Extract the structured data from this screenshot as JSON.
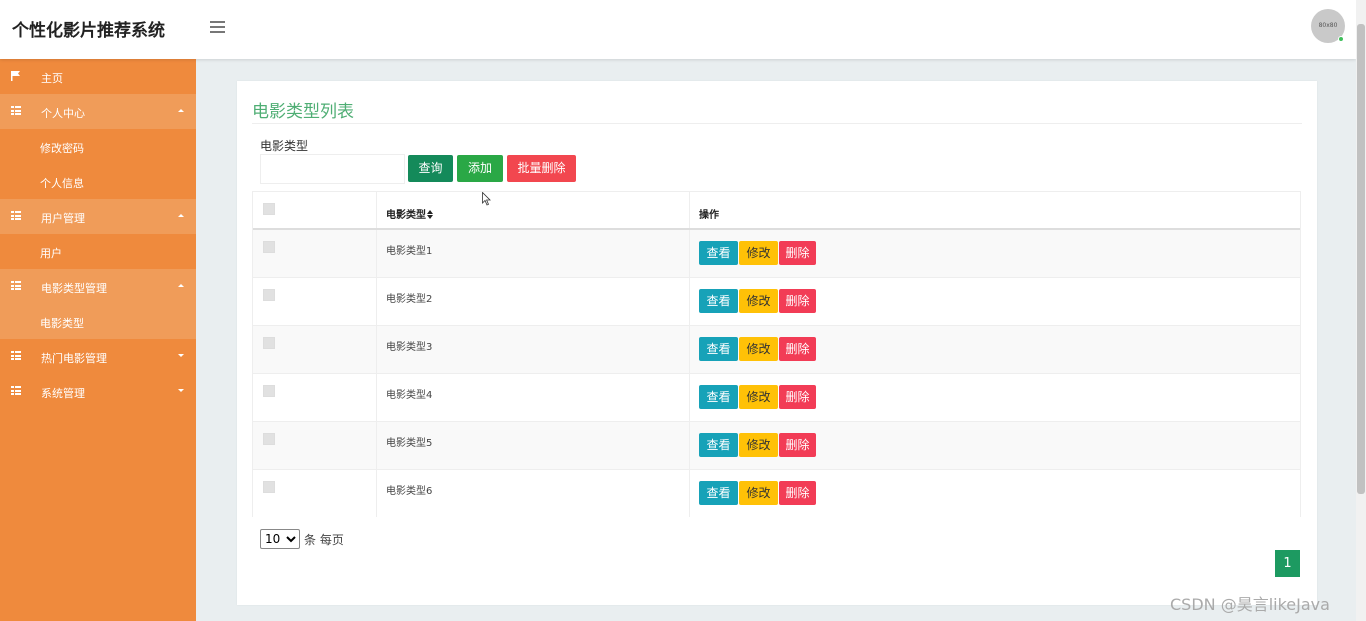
{
  "app": {
    "title": "个性化影片推荐系统"
  },
  "header": {
    "avatar_text": "80x80"
  },
  "sidebar": {
    "home": "主页",
    "groups": [
      {
        "label": "个人中心",
        "expanded": true,
        "items": [
          "修改密码",
          "个人信息"
        ]
      },
      {
        "label": "用户管理",
        "expanded": true,
        "items": [
          "用户"
        ]
      },
      {
        "label": "电影类型管理",
        "expanded": true,
        "items": [
          "电影类型"
        ]
      },
      {
        "label": "热门电影管理",
        "expanded": false,
        "items": []
      },
      {
        "label": "系统管理",
        "expanded": false,
        "items": []
      }
    ],
    "active_item": "电影类型"
  },
  "page": {
    "title": "电影类型列表",
    "search": {
      "label": "电影类型",
      "value": "",
      "placeholder": ""
    },
    "buttons": {
      "query": "查询",
      "add": "添加",
      "batch_delete": "批量删除"
    }
  },
  "table": {
    "columns": {
      "name": "电影类型",
      "sort_icon": "sort-icon",
      "ops": "操作"
    },
    "rows": [
      {
        "name": "电影类型1"
      },
      {
        "name": "电影类型2"
      },
      {
        "name": "电影类型3"
      },
      {
        "name": "电影类型4"
      },
      {
        "name": "电影类型5"
      },
      {
        "name": "电影类型6"
      }
    ],
    "row_actions": {
      "view": "查看",
      "edit": "修改",
      "delete": "删除"
    }
  },
  "pagination": {
    "page_size": "10",
    "page_size_options": [
      "10"
    ],
    "per_page_text": "条 每页",
    "current_page": "1"
  },
  "watermark": "CSDN @昊言likeJava",
  "colors": {
    "sidebar": "#ef8a3d",
    "sidebar_group": "#f09c59",
    "title": "#4fae74",
    "page_active": "#1d9a61"
  }
}
